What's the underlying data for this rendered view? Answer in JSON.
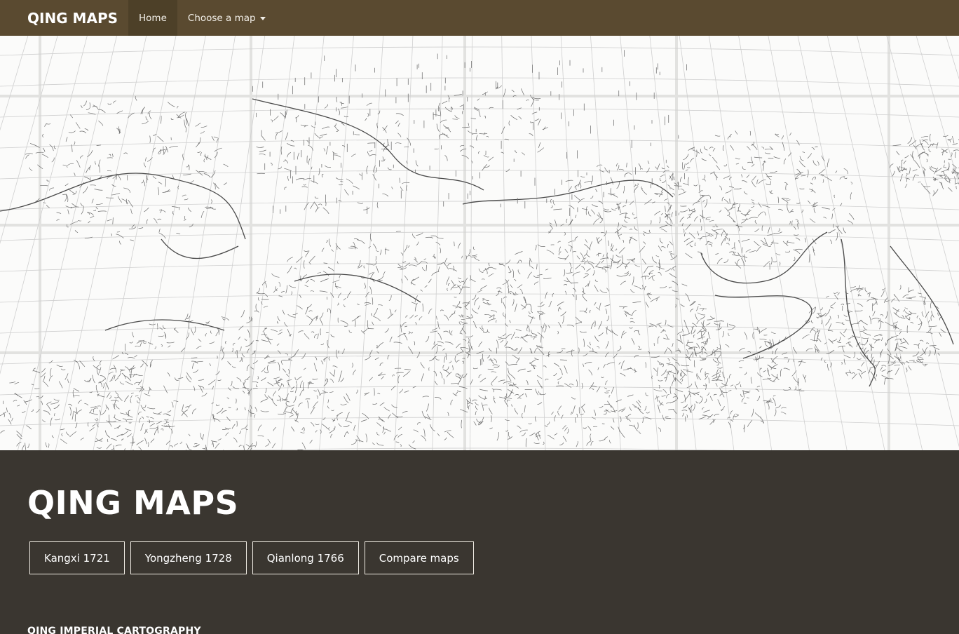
{
  "navbar": {
    "brand": "QING MAPS",
    "home_label": "Home",
    "choose_label": "Choose a map"
  },
  "hero": {
    "description": "Qing-era map scan"
  },
  "intro": {
    "title": "QING MAPS",
    "buttons": [
      {
        "label": "Kangxi 1721"
      },
      {
        "label": "Yongzheng 1728"
      },
      {
        "label": "Qianlong 1766"
      },
      {
        "label": "Compare maps"
      }
    ],
    "section_heading": "QING IMPERIAL CARTOGRAPHY"
  },
  "colors": {
    "navbar_bg": "#5a4a30",
    "active_nav_bg": "#4d4028",
    "intro_bg": "#3a3630",
    "text": "#ffffff"
  }
}
